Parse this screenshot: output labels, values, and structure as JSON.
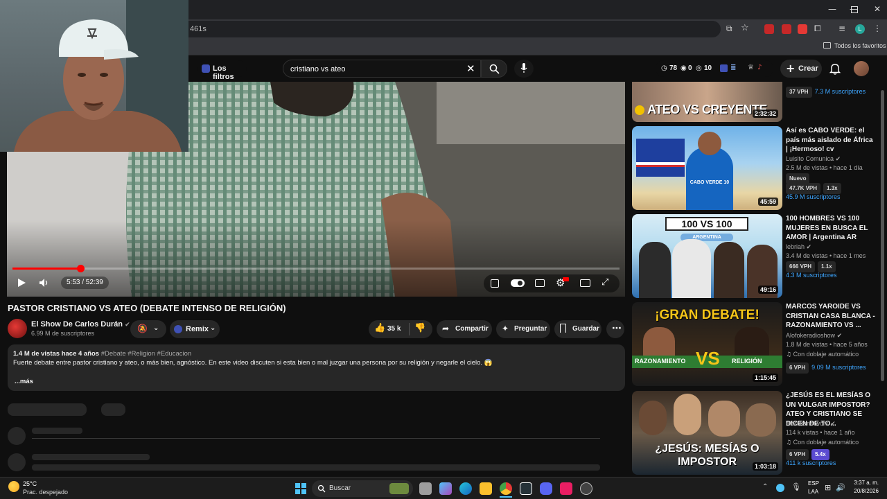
{
  "browser": {
    "url_fragment": "461s",
    "bookmarks_label": "Todos los favoritos",
    "profile_initial": "L"
  },
  "youtube_header": {
    "filters_label": "Los filtros",
    "search_value": "cristiano vs ateo",
    "stats": {
      "views": "78",
      "likes": "0",
      "comments": "10"
    },
    "create_label": "Crear"
  },
  "player": {
    "time": "5:53 / 52:39",
    "progress": 0.112
  },
  "video": {
    "title": "PASTOR CRISTIANO VS ATEO (DEBATE INTENSO DE RELIGIÓN)",
    "channel": "El Show De Carlos Durán",
    "subscribers": "6.99 M de suscriptores",
    "remix_label": "Remix",
    "likes": "35 k",
    "share_label": "Compartir",
    "ask_label": "Preguntar",
    "save_label": "Guardar",
    "views_age": "1.4 M de vistas  hace 4 años",
    "hashtags": "#Debate #Religion #Educacion",
    "description": "Fuerte debate entre pastor cristiano y ateo, o más bien, agnóstico. En este video discuten si esta bien o mal juzgar una persona por su religión y negarle el cielo. 😱",
    "more_label": "...más"
  },
  "recommendations": [
    {
      "thumb_text": "ATEO VS CREYENTE",
      "duration": "2:32:32",
      "vph": "37 VPH",
      "subs": "7.3 M suscriptores"
    },
    {
      "title": "Así es CABO VERDE: el país más aislado de África | ¡Hermoso! cv",
      "channel": "Luisito Comunica",
      "meta": "2.5 M de vistas • hace 1 día",
      "badge": "Nuevo",
      "vph": "47.7K VPH",
      "ratio": "1.3x",
      "subs": "45.9 M suscriptores",
      "duration": "45:59",
      "thumb_text": "CABO VERDE 10"
    },
    {
      "title": "100 HOMBRES VS 100 MUJERES EN BUSCA EL AMOR | Argentina AR",
      "channel": "lebriah",
      "meta": "3.4 M de vistas • hace 1 mes",
      "vph": "666 VPH",
      "ratio": "1.1x",
      "subs": "4.3 M suscriptores",
      "duration": "49:16",
      "thumb_text": "100 VS 100",
      "thumb_sub": "ARGENTINA"
    },
    {
      "title": "MARCOS YAROIDE VS CRISTIAN CASA BLANCA - RAZONAMIENTO VS ...",
      "channel": "Alofokeradioshow",
      "meta": "1.8 M de vistas • hace 5 años",
      "dub": "Con doblaje automático",
      "vph": "6 VPH",
      "subs": "9.09 M suscriptores",
      "duration": "1:15:45",
      "thumb_text": "¡GRAN DEBATE!",
      "thumb_left": "RAZONAMIENTO",
      "thumb_right": "RELIGIÓN"
    },
    {
      "title": "¿JESÚS ES EL MESÍAS O UN VULGAR IMPOSTOR? ATEO Y CRISTIANO SE DICEN DE TO...",
      "channel": "Alofokenetwork",
      "meta": "114 k vistas • hace 1 año",
      "dub": "Con doblaje automático",
      "vph": "6 VPH",
      "ratio": "5.4x",
      "subs": "411 k suscriptores",
      "duration": "1:03:18",
      "thumb_text": "¿JESÚS: MESÍAS O IMPOSTOR"
    }
  ],
  "taskbar": {
    "weather_temp": "25°C",
    "weather_desc": "Prac. despejado",
    "search_label": "Buscar",
    "lang": "ESP",
    "lang2": "LAA",
    "time": "3:37 a. m.",
    "date": "20/8/2026"
  },
  "colors": {
    "accent_red": "#ff0000",
    "link_blue": "#3ea6ff",
    "bg": "#0f0f0f"
  }
}
